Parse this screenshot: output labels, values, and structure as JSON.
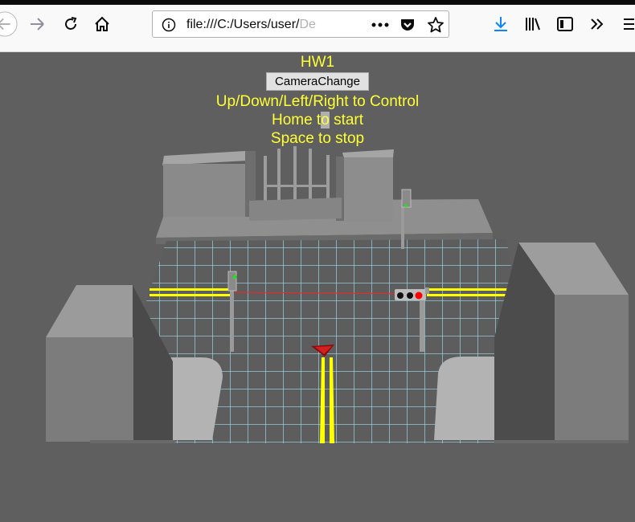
{
  "browser": {
    "url_visible": "file:///C:/Users/user/",
    "url_faded": "De",
    "icons": [
      "back-arrow-icon",
      "forward-arrow-icon",
      "reload-icon",
      "home-icon",
      "info-icon",
      "more-dots-icon",
      "pocket-icon",
      "star-icon",
      "download-icon",
      "library-icon",
      "sidebar-icon",
      "overflow-chevrons-icon",
      "menu-icon"
    ]
  },
  "hud": {
    "title": "HW1",
    "camera_button": "CameraChange",
    "instruction_1": "Up/Down/Left/Right to Control",
    "instruction_2_a": "Home t",
    "instruction_2_hl": "o",
    "instruction_2_b": " start",
    "instruction_3": "Space to stop"
  },
  "colors": {
    "hud_text": "#ffff33",
    "road_line": "#ffff00",
    "grid_line": "#9fdcef",
    "red_light": "#ff0000",
    "green_light": "#22dd22",
    "car": "#cc1a1a"
  }
}
